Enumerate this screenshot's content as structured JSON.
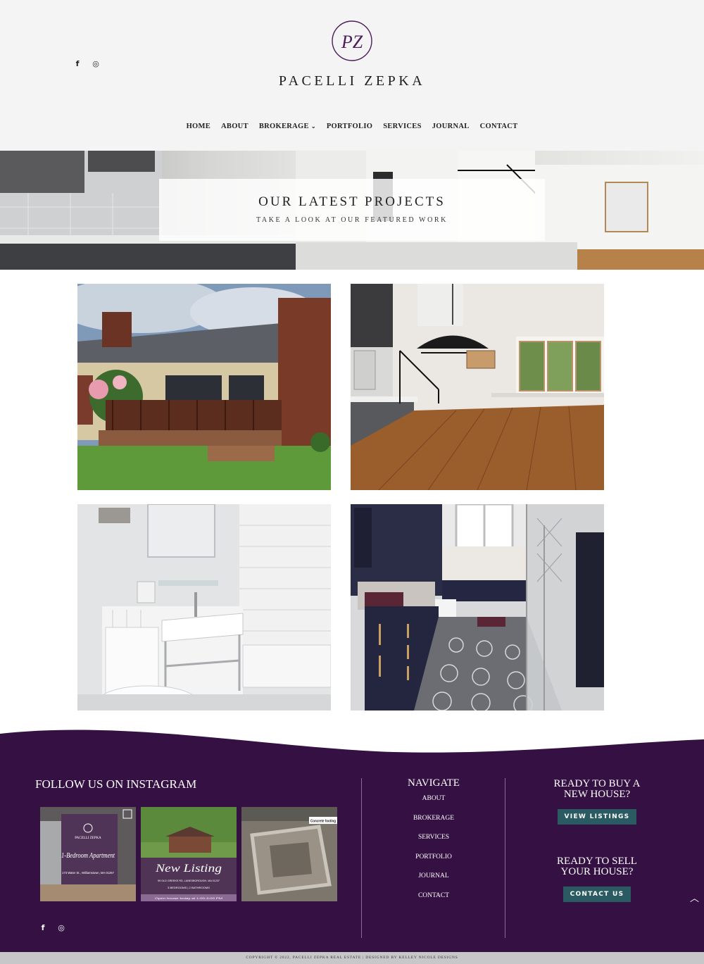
{
  "header": {
    "logo_monogram": "PZ",
    "logo_text": "PACELLI ZEPKA",
    "social": [
      {
        "icon": "facebook-icon",
        "glyph": "f"
      },
      {
        "icon": "instagram-icon",
        "glyph": "◎"
      }
    ],
    "nav": {
      "home": "HOME",
      "about": "ABOUT",
      "brokerage": "BROKERAGE",
      "brokerage_chevron": "⌄",
      "portfolio": "PORTFOLIO",
      "services": "SERVICES",
      "journal": "JOURNAL",
      "contact": "CONTACT"
    }
  },
  "hero": {
    "title": "OUR LATEST PROJECTS",
    "subtitle": "TAKE A LOOK AT OUR FEATURED WORK"
  },
  "portfolio": {
    "photos": [
      "exterior deck project",
      "open living room project",
      "white bathroom project",
      "navy bathroom project"
    ]
  },
  "footer": {
    "instagram_title": "FOLLOW US ON INSTAGRAM",
    "posts": {
      "post1": {
        "brand": "PACELLI ZEPKA",
        "script": "1-Bedroom Apartment",
        "address": "173 Water St., Williamstown, MA 01267"
      },
      "post2": {
        "script": "New Listing",
        "address": "99 OLD GREEKE RD, LANESBOROUGH, MA 01237",
        "details": "3 BEDROOMS | 2 BATHROOMS",
        "open_house": "Open house today at 1:00-3:00 PM"
      },
      "post3": {
        "badge": "Concrete footing"
      }
    },
    "social": [
      {
        "icon": "facebook-icon",
        "glyph": "f"
      },
      {
        "icon": "instagram-icon",
        "glyph": "◎"
      }
    ],
    "navigate": {
      "title": "NAVIGATE",
      "items": [
        "ABOUT",
        "BROKERAGE",
        "SERVICES",
        "PORTFOLIO",
        "JOURNAL",
        "CONTACT"
      ]
    },
    "cta_buy": {
      "title_line1": "READY TO BUY A",
      "title_line2": "NEW HOUSE?",
      "button": "VIEW LISTINGS"
    },
    "cta_sell": {
      "title_line1": "READY TO SELL",
      "title_line2": "YOUR HOUSE?",
      "button": "CONTACT US"
    },
    "scroll_top_glyph": "︿",
    "copyright": "COPYRIGHT © 2022, PACELLI ZEPKA REAL ESTATE | DESIGNED BY KELLEY NICOLE DESIGNS"
  },
  "colors": {
    "footer_bg": "#341142",
    "button_bg": "#2a5b62",
    "header_bg": "#f4f4f4",
    "logo_purple": "#4a1c5a"
  }
}
